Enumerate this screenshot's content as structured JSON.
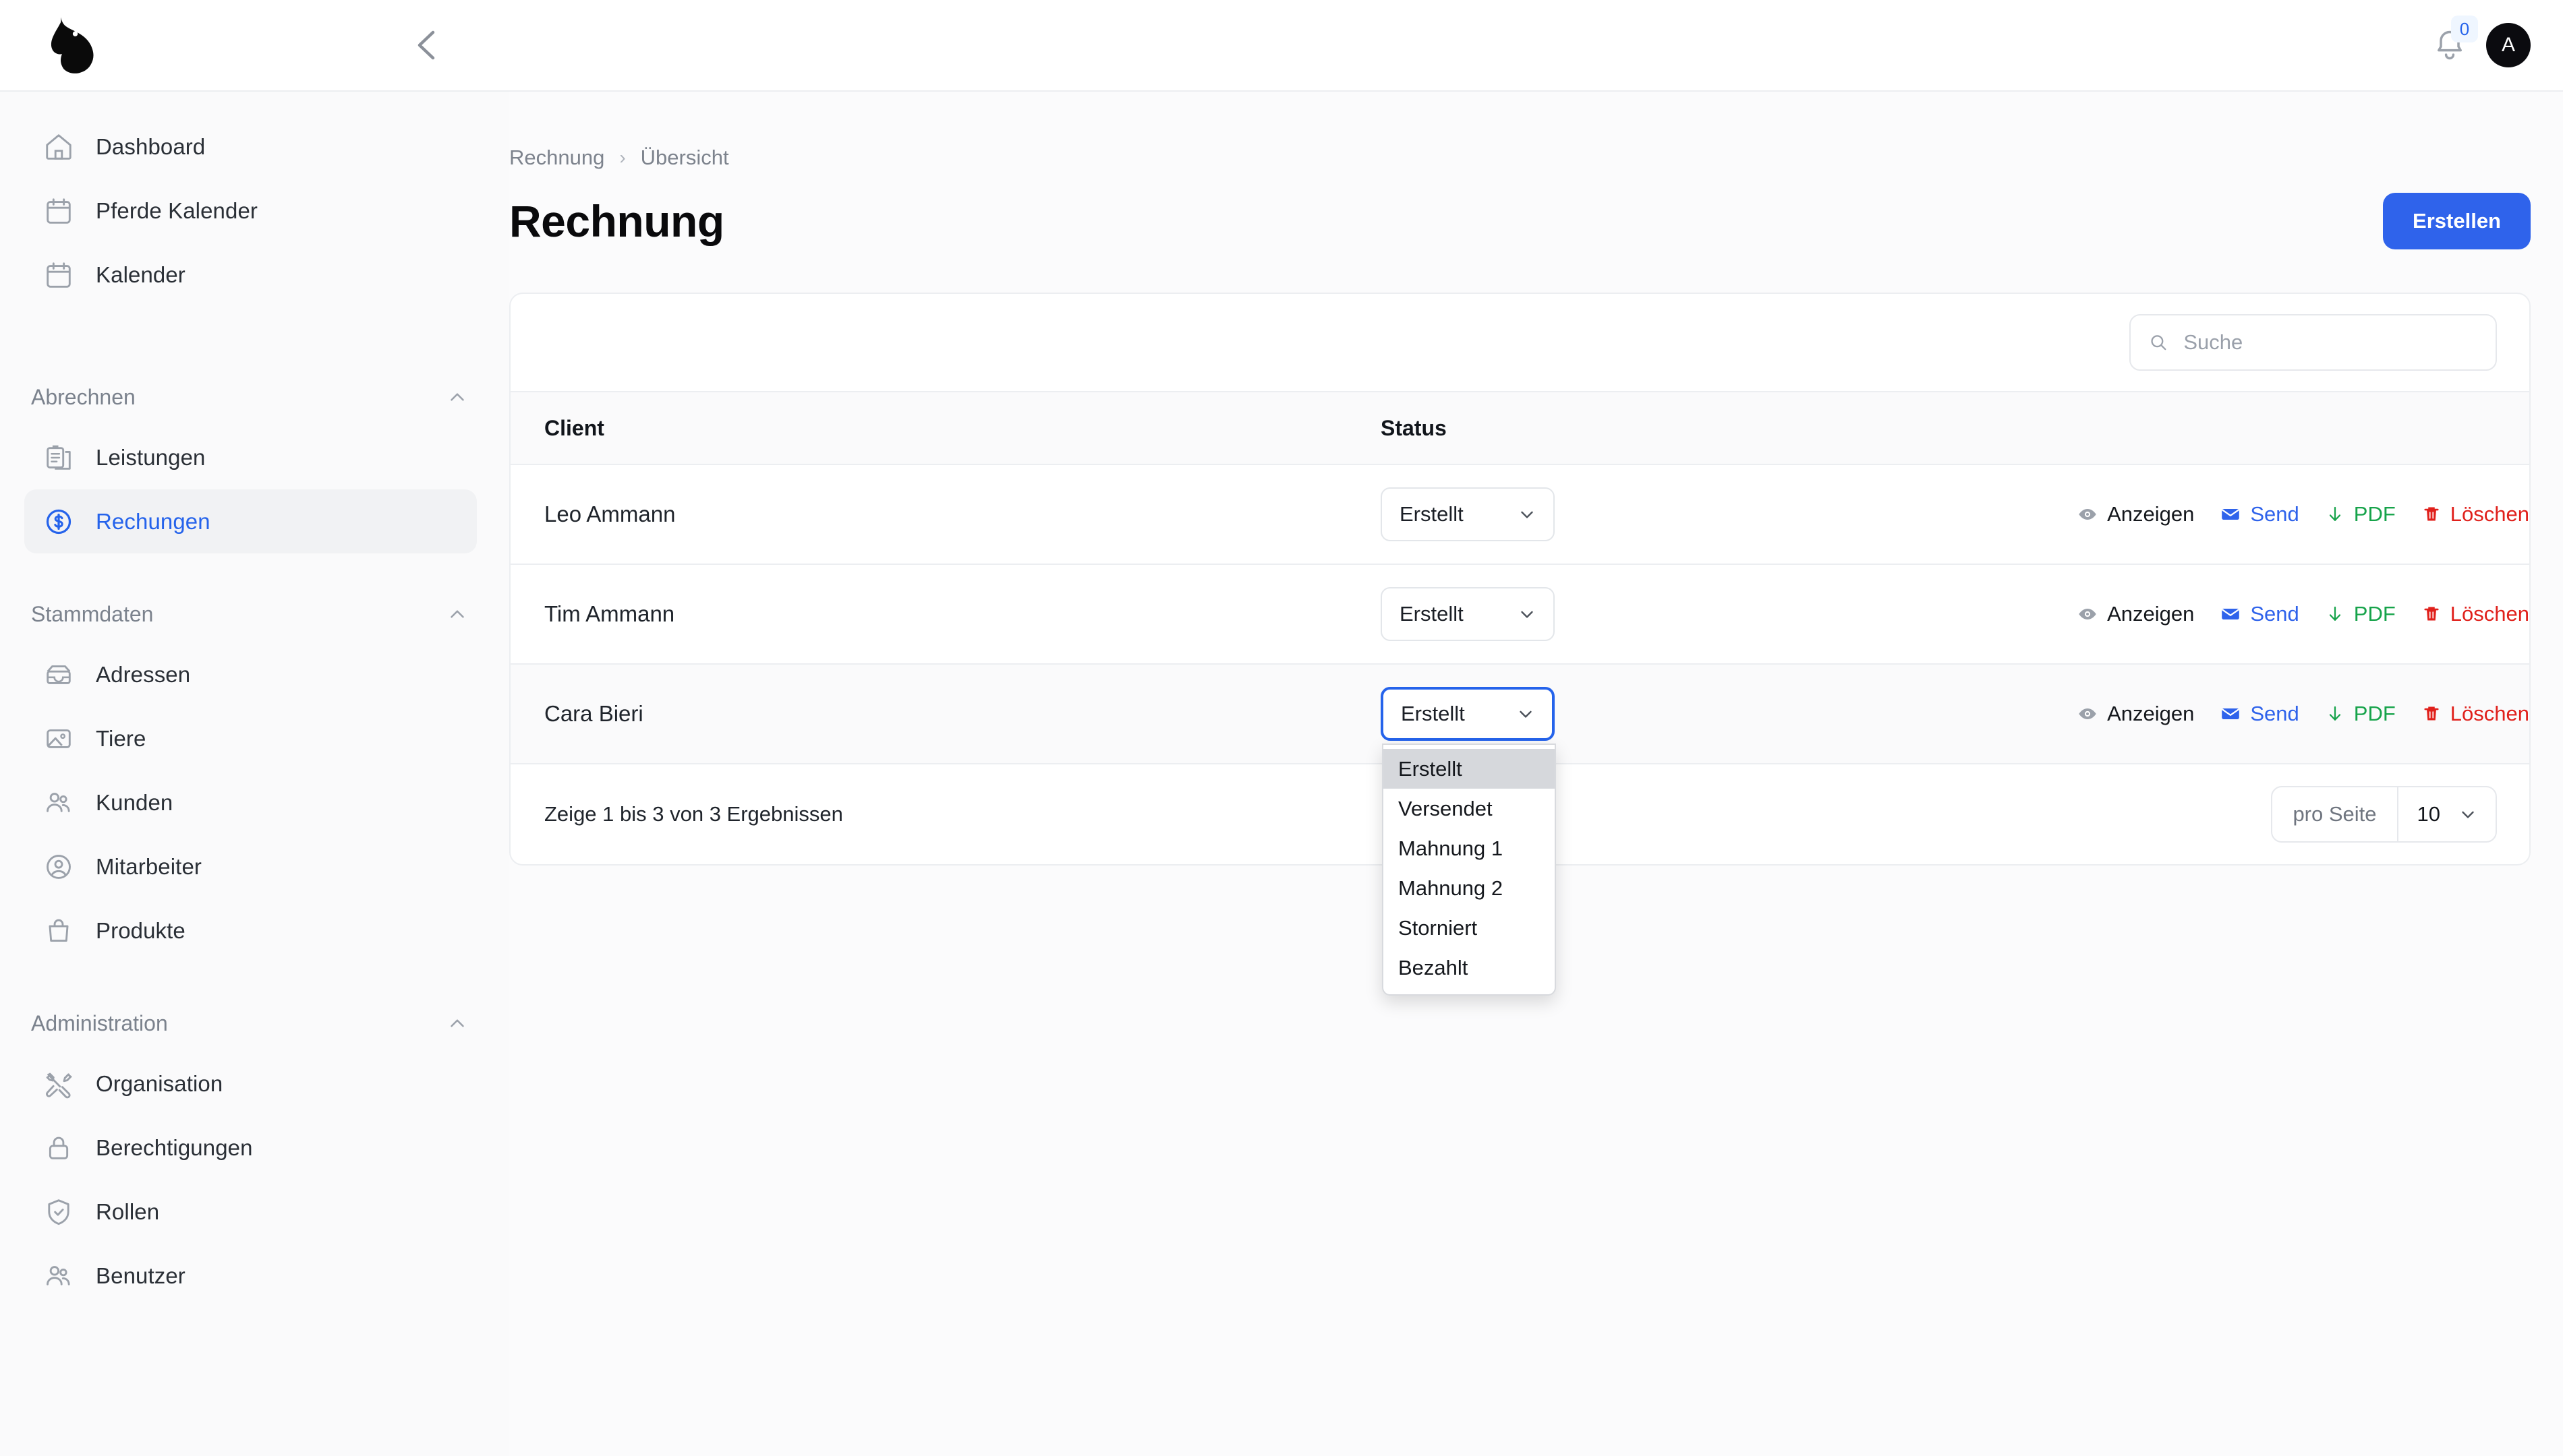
{
  "topbar": {
    "logo_alt": "horse-head-logo",
    "collapse_icon": "chevron-left-icon",
    "notification_icon": "bell-icon",
    "notification_count": "0",
    "avatar_initial": "A"
  },
  "sidebar": {
    "top_items": [
      {
        "label": "Dashboard",
        "icon": "home-icon",
        "name": "sidebar-item-dashboard"
      },
      {
        "label": "Pferde Kalender",
        "icon": "calendar-icon",
        "name": "sidebar-item-pferde-kalender"
      },
      {
        "label": "Kalender",
        "icon": "calendar-icon",
        "name": "sidebar-item-kalender"
      }
    ],
    "groups": [
      {
        "title": "Abrechnen",
        "collapse_icon": "chevron-up-icon",
        "items": [
          {
            "label": "Leistungen",
            "icon": "clipboard-icon",
            "name": "sidebar-item-leistungen",
            "active": false
          },
          {
            "label": "Rechungen",
            "icon": "dollar-circle-icon",
            "name": "sidebar-item-rechungen",
            "active": true
          }
        ]
      },
      {
        "title": "Stammdaten",
        "collapse_icon": "chevron-up-icon",
        "items": [
          {
            "label": "Adressen",
            "icon": "archive-icon",
            "name": "sidebar-item-adressen",
            "active": false
          },
          {
            "label": "Tiere",
            "icon": "image-icon",
            "name": "sidebar-item-tiere",
            "active": false
          },
          {
            "label": "Kunden",
            "icon": "users-icon",
            "name": "sidebar-item-kunden",
            "active": false
          },
          {
            "label": "Mitarbeiter",
            "icon": "user-circle-icon",
            "name": "sidebar-item-mitarbeiter",
            "active": false
          },
          {
            "label": "Produkte",
            "icon": "bag-icon",
            "name": "sidebar-item-produkte",
            "active": false
          }
        ]
      },
      {
        "title": "Administration",
        "collapse_icon": "chevron-up-icon",
        "items": [
          {
            "label": "Organisation",
            "icon": "tools-icon",
            "name": "sidebar-item-organisation",
            "active": false
          },
          {
            "label": "Berechtigungen",
            "icon": "lock-icon",
            "name": "sidebar-item-berechtigungen",
            "active": false
          },
          {
            "label": "Rollen",
            "icon": "shield-check-icon",
            "name": "sidebar-item-rollen",
            "active": false
          },
          {
            "label": "Benutzer",
            "icon": "users-icon",
            "name": "sidebar-item-benutzer",
            "active": false
          }
        ]
      }
    ]
  },
  "breadcrumb": {
    "parent": "Rechnung",
    "separator": "›",
    "current": "Übersicht"
  },
  "page": {
    "title": "Rechnung",
    "create_button": "Erstellen"
  },
  "search": {
    "placeholder": "Suche",
    "value": "",
    "icon": "search-icon"
  },
  "table": {
    "columns": [
      "Client",
      "Status"
    ],
    "rows": [
      {
        "client": "Leo Ammann",
        "status": "Erstellt",
        "hovered": false,
        "dropdown_open": false
      },
      {
        "client": "Tim Ammann",
        "status": "Erstellt",
        "hovered": false,
        "dropdown_open": false
      },
      {
        "client": "Cara Bieri",
        "status": "Erstellt",
        "hovered": true,
        "dropdown_open": true
      }
    ],
    "row_actions": [
      {
        "label": "Anzeigen",
        "icon": "eye-icon",
        "style": "view",
        "name": "action-anzeigen"
      },
      {
        "label": "Send",
        "icon": "envelope-icon",
        "style": "send",
        "name": "action-send"
      },
      {
        "label": "PDF",
        "icon": "download-arrow-icon",
        "style": "pdf",
        "name": "action-pdf"
      },
      {
        "label": "Löschen",
        "icon": "trash-icon",
        "style": "del",
        "name": "action-loeschen"
      }
    ]
  },
  "status_dropdown": {
    "selected": "Erstellt",
    "options": [
      "Erstellt",
      "Versendet",
      "Mahnung 1",
      "Mahnung 2",
      "Storniert",
      "Bezahlt"
    ]
  },
  "footer": {
    "results_text": "Zeige 1 bis 3 von 3 Ergebnissen",
    "per_page_label": "pro Seite",
    "per_page_value": "10",
    "chevron_icon": "chevron-down-icon"
  },
  "colors": {
    "accent": "#2f63eb",
    "danger": "#e0201b",
    "success": "#16a34a",
    "muted": "#7d838d",
    "page_bg": "#fbfbfc",
    "card_border": "#eceef1"
  }
}
